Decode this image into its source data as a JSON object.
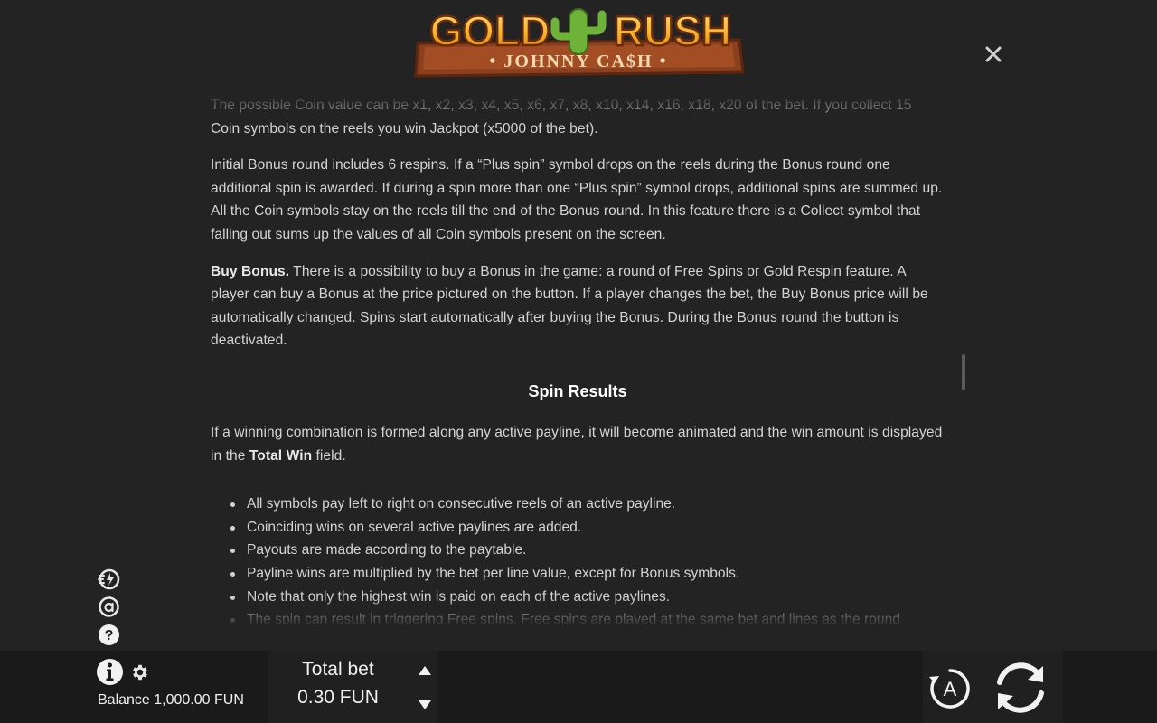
{
  "header": {
    "logo_title_left": "GOLD",
    "logo_title_right": "RUSH",
    "logo_subtitle": "• JOHNNY CA$H •",
    "close_icon": "close-icon"
  },
  "rules": {
    "para_coin_value": "The possible Coin value can be x1, x2, x3, x4, x5, x6, x7, x8, x10, x14, x16, x18, x20 of the bet. If you collect 15 Coin symbols on the reels you win Jackpot (x5000 of the bet).",
    "para_bonus_round": "Initial Bonus round includes 6 respins. If a “Plus spin” symbol drops on the reels during the Bonus round one additional spin is awarded. If during a spin more than one “Plus spin” symbol drops, additional spins are summed up. All the Coin symbols stay on the reels till the end of the Bonus round. In this feature there is a Collect symbol that falling out sums up the values of all Coin symbols present on the screen.",
    "buy_bonus_label": "Buy Bonus.",
    "buy_bonus_text": " There is a possibility to buy a Bonus in the game: a round of Free Spins or Gold Respin feature. A player can buy a Bonus at the price pictured on the button. If a player changes the bet, the Buy Bonus price will be automatically changed. Spins start automatically after buying the Bonus. During the Bonus round the button is deactivated.",
    "spin_results_title": "Spin Results",
    "spin_results_intro_before": "If a winning combination is formed along any active payline, it will become animated and the win amount is displayed in the ",
    "spin_results_intro_bold": "Total Win",
    "spin_results_intro_after": " field.",
    "bullets": [
      "All symbols pay left to right on consecutive reels of an active payline.",
      "Coinciding wins on several active paylines are added.",
      "Payouts are made according to the paytable.",
      "Payline wins are multiplied by the bet per line value, except for Bonus symbols.",
      "Note that only the highest win is paid on each of the active paylines.",
      "The spin can result in triggering Free spins. Free spins are played at the same bet and lines as the round"
    ]
  },
  "side_icons": [
    "turbo-icon",
    "autoplay-settings-icon",
    "help-icon"
  ],
  "bottom_bar": {
    "balance": "Balance 1,000.00 FUN",
    "total_bet_label": "Total bet",
    "total_bet_value": "0.30 FUN",
    "icons": [
      "info-icon",
      "gear-icon",
      "arrow-up-icon",
      "arrow-down-icon",
      "autoplay-icon",
      "spin-icon"
    ],
    "autoplay_letter": "A"
  },
  "colors": {
    "background": "#232323",
    "bottom_bar": "#1a1a1a",
    "text": "#d4d4d4",
    "logo_gold": "#f6b52a",
    "logo_wood": "#8a3f1e",
    "cactus": "#6fb23a"
  }
}
